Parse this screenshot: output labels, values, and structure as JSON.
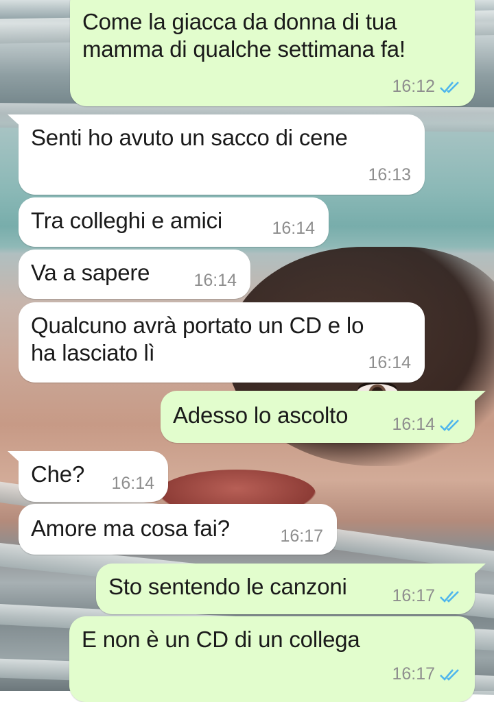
{
  "conversation": {
    "messages": [
      {
        "direction": "out",
        "text_lines": [
          "Come la giacca da donna di tua",
          "mamma di qualche settimana fa!"
        ],
        "time": "16:12",
        "status": "read"
      },
      {
        "direction": "in",
        "text_lines": [
          "Senti ho avuto un sacco di cene"
        ],
        "time": "16:13"
      },
      {
        "direction": "in",
        "text_lines": [
          "Tra colleghi e amici"
        ],
        "time": "16:14"
      },
      {
        "direction": "in",
        "text_lines": [
          "Va a sapere"
        ],
        "time": "16:14"
      },
      {
        "direction": "in",
        "text_lines": [
          "Qualcuno avrà portato un CD e lo",
          "ha lasciato lì"
        ],
        "time": "16:14"
      },
      {
        "direction": "out",
        "text_lines": [
          "Adesso lo ascolto"
        ],
        "time": "16:14",
        "status": "read"
      },
      {
        "direction": "in",
        "text_lines": [
          "Che?"
        ],
        "time": "16:14"
      },
      {
        "direction": "in",
        "text_lines": [
          "Amore ma cosa fai?"
        ],
        "time": "16:17"
      },
      {
        "direction": "out",
        "text_lines": [
          "Sto sentendo le canzoni"
        ],
        "time": "16:17",
        "status": "read"
      },
      {
        "direction": "out",
        "text_lines": [
          "E non è un CD di un collega"
        ],
        "time": "16:17",
        "status": "read"
      }
    ]
  },
  "theme": {
    "incoming_bubble": "#ffffff",
    "outgoing_bubble": "#e2fdcd",
    "read_tick_color": "#4fb6ec",
    "time_color": "#8e8e8e"
  },
  "icons": {
    "read_status": "double-check-icon"
  }
}
